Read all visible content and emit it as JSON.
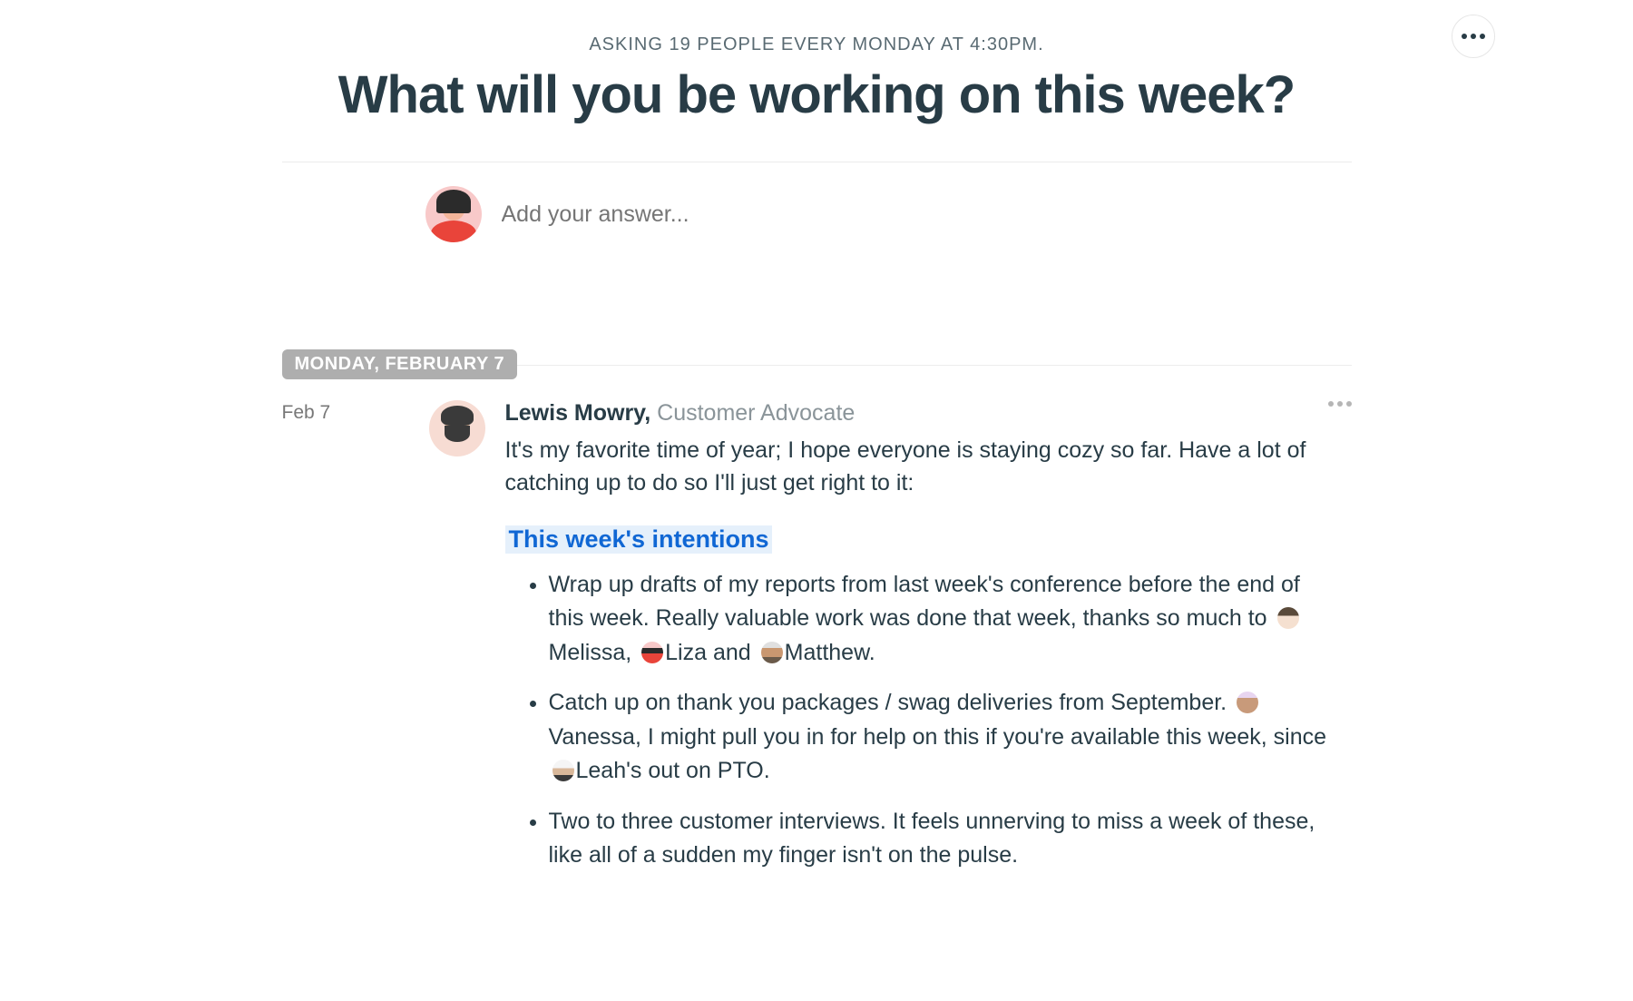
{
  "header": {
    "subtitle": "ASKING 19 PEOPLE EVERY MONDAY AT 4:30PM.",
    "title": "What will you be working on this week?"
  },
  "answer": {
    "placeholder": "Add your answer..."
  },
  "divider": {
    "date_label": "MONDAY, FEBRUARY 7"
  },
  "post": {
    "date": "Feb 7",
    "author_name": "Lewis Mowry,",
    "author_role": " Customer Advocate",
    "intro": "It's my favorite time of year; I hope everyone is staying cozy so far. Have a lot of catching up to do so I'll just get right to it:",
    "section_heading": "This week's intentions",
    "items": {
      "0": {
        "t1": "Wrap up drafts of my reports from last week's conference before the end of this week. Really valuable work was done that week, thanks so much to ",
        "m1": "Melissa",
        "t2": ", ",
        "m2": "Liza",
        "t3": " and ",
        "m3": "Matthew",
        "t4": "."
      },
      "1": {
        "t1": "Catch up on thank you packages / swag deliveries from September. ",
        "m1": "Vanessa",
        "t2": ", I might pull you in for help on this if you're available this week, since ",
        "m2": "Leah",
        "t3": "'s out on PTO."
      },
      "2": {
        "t1": "Two to three customer interviews. It feels unnerving to miss a week of these, like all of a sudden my finger isn't on the pulse."
      }
    }
  }
}
